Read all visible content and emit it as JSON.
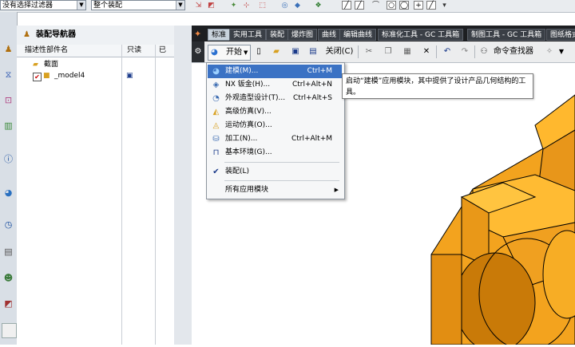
{
  "topbar": {
    "filter_combo": "没有选择过滤器",
    "assembly_combo": "整个装配",
    "icons": [
      "select-icon",
      "snap-icon",
      "point-icon",
      "box-select-icon",
      "layer-icon",
      "view-icon",
      "grid-icon",
      "line-icon",
      "arc-icon",
      "circle-icon",
      "plus-icon",
      "curve-icon"
    ]
  },
  "left_column": {
    "icons": [
      "assembly-navigator-icon",
      "constraint-icon",
      "part-navigator-icon",
      "library-icon",
      "info-icon",
      "web-icon",
      "history-icon",
      "process-icon",
      "roles-icon",
      "system-icon",
      "palette-icon"
    ]
  },
  "navigator": {
    "title": "装配导航器",
    "columns": [
      "描述性部件名",
      "只读",
      "已"
    ],
    "rows": [
      {
        "label": "截面",
        "icon": "folder-icon"
      },
      {
        "label": "_model4",
        "icon": "part-icon",
        "checked": true,
        "readonly_icon": "save-icon"
      }
    ]
  },
  "tabs": [
    "标准",
    "实用工具",
    "装配",
    "爆炸图",
    "曲线",
    "编辑曲线",
    "标准化工具 - GC 工具箱",
    "制图工具 - GC 工具箱",
    "图纸格式"
  ],
  "toolbar": {
    "start_label": "开始",
    "close_label": "关闭(C)",
    "command_finder": "命令查找器"
  },
  "start_menu": {
    "items": [
      {
        "label": "建模(M)...",
        "shortcut": "Ctrl+M",
        "icon": "modeling-icon",
        "highlighted": true
      },
      {
        "label": "NX 钣金(H)...",
        "shortcut": "Ctrl+Alt+N",
        "icon": "sheet-metal-icon"
      },
      {
        "label": "外观造型设计(T)...",
        "shortcut": "Ctrl+Alt+S",
        "icon": "shape-studio-icon"
      },
      {
        "label": "高级仿真(V)...",
        "shortcut": "",
        "icon": "advanced-simulation-icon"
      },
      {
        "label": "运动仿真(O)...",
        "shortcut": "",
        "icon": "motion-simulation-icon"
      },
      {
        "label": "加工(N)...",
        "shortcut": "Ctrl+Alt+M",
        "icon": "manufacturing-icon"
      },
      {
        "label": "基本环境(G)...",
        "shortcut": "",
        "icon": "gateway-icon"
      },
      {
        "label": "装配(L)",
        "shortcut": "",
        "icon": "check-icon",
        "checked": true
      },
      {
        "label": "所有应用模块",
        "shortcut": "",
        "icon": "",
        "submenu": true
      }
    ]
  },
  "tooltip": {
    "text": "启动“建模”应用模块，其中提供了设计产品几何结构的工具。"
  },
  "colors": {
    "model_orange": "#f0a020",
    "model_shadow": "#b26a00",
    "highlight": "#3b72c4",
    "tab_bar": "#1d1f22"
  }
}
